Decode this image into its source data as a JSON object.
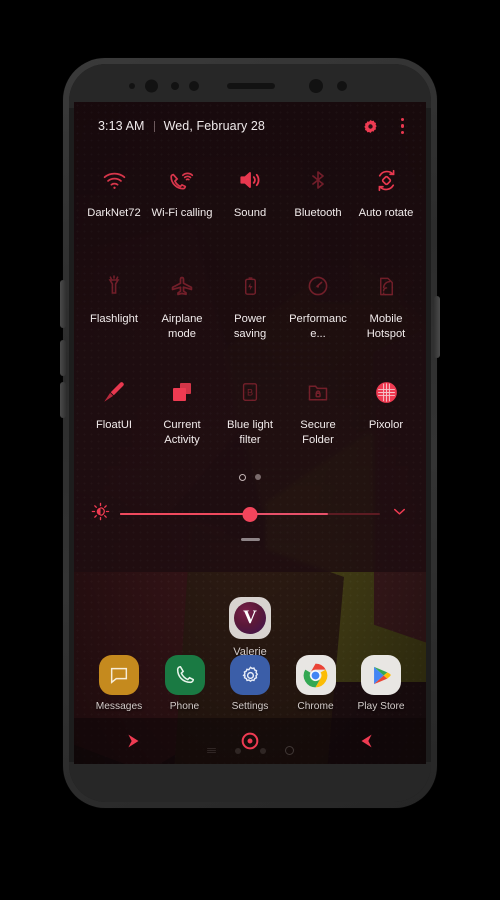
{
  "theme": {
    "accent": "#ef3b52",
    "accent_bright": "#f2455c",
    "label_color": "#f2ecec",
    "screen_bg": "#221013"
  },
  "status_bar": {
    "time": "3:13 AM",
    "separator": "|",
    "date": "Wed, February 28",
    "gear_icon": "gear-icon",
    "overflow_icon": "overflow-menu-icon"
  },
  "quick_settings": {
    "tiles": [
      {
        "label": "DarkNet72",
        "icon": "wifi-icon",
        "state": "on"
      },
      {
        "label": "Wi-Fi calling",
        "icon": "wifi-call-icon",
        "state": "on"
      },
      {
        "label": "Sound",
        "icon": "volume-icon",
        "state": "on"
      },
      {
        "label": "Bluetooth",
        "icon": "bluetooth-icon",
        "state": "dim"
      },
      {
        "label": "Auto rotate",
        "icon": "auto-rotate-icon",
        "state": "on"
      },
      {
        "label": "Flashlight",
        "icon": "flashlight-icon",
        "state": "dim"
      },
      {
        "label": "Airplane mode",
        "icon": "airplane-icon",
        "state": "dim"
      },
      {
        "label": "Power saving",
        "icon": "battery-icon",
        "state": "dim"
      },
      {
        "label": "Performance...",
        "icon": "gauge-icon",
        "state": "dim"
      },
      {
        "label": "Mobile Hotspot",
        "icon": "hotspot-icon",
        "state": "dim"
      },
      {
        "label": "FloatUI",
        "icon": "pen-icon",
        "state": "on"
      },
      {
        "label": "Current Activity",
        "icon": "squares-icon",
        "state": "on"
      },
      {
        "label": "Blue light filter",
        "icon": "blue-light-icon",
        "state": "dim"
      },
      {
        "label": "Secure Folder",
        "icon": "secure-folder-icon",
        "state": "dim"
      },
      {
        "label": "Pixolor",
        "icon": "pixolor-grid-icon",
        "state": "on"
      }
    ],
    "pager": {
      "pages": 2,
      "active_page": 1
    }
  },
  "brightness": {
    "icon": "brightness-icon",
    "value_percent": 50,
    "expand_icon": "chevron-down-icon",
    "drag_handle": "panel-drag-handle"
  },
  "home": {
    "apps": [
      {
        "label": "Valerie",
        "icon": "valerie-app-icon",
        "glyph": "V"
      }
    ],
    "pager": {
      "pages": 4,
      "active_page": 4
    }
  },
  "dock": {
    "apps": [
      {
        "label": "Messages",
        "icon": "messages-icon",
        "color": "#c58a1e"
      },
      {
        "label": "Phone",
        "icon": "phone-icon",
        "color": "#1a7a43"
      },
      {
        "label": "Settings",
        "icon": "settings-icon",
        "color": "#3b5ea8"
      },
      {
        "label": "Chrome",
        "icon": "chrome-icon",
        "color": "#e8e6e3"
      },
      {
        "label": "Play Store",
        "icon": "play-store-icon",
        "color": "#e8e6e3"
      }
    ]
  },
  "nav_bar": {
    "buttons": [
      {
        "name": "recents-button",
        "icon": "arrow-right-icon"
      },
      {
        "name": "home-button",
        "icon": "circle-dot-icon"
      },
      {
        "name": "back-button",
        "icon": "arrow-left-icon"
      }
    ]
  }
}
